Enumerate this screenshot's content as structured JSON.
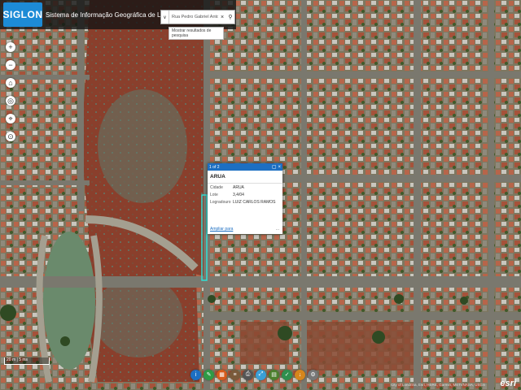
{
  "header": {
    "logo": "SIGLON",
    "title": "Sistema de Informação Geográfica de Londrina"
  },
  "search": {
    "value": "Rua Pedro Gabriel Antonio",
    "suggestion": "Mostrar resultados de pesquisa"
  },
  "nav_buttons": [
    "+",
    "−",
    "⌂",
    "◎",
    "⌖",
    "⊙"
  ],
  "popup": {
    "nav": "1 of 2",
    "title": "ARUA",
    "attributes": [
      {
        "key": "Cidade",
        "value": "ARUA"
      },
      {
        "key": "Lote",
        "value": "3,4/04"
      },
      {
        "key": "Logradouro",
        "value": "LUIZ CARLOS RAMOS"
      }
    ],
    "footer": "Ampliar para",
    "more": "..."
  },
  "toolbar": [
    {
      "icon": "info-icon",
      "color": "#1d6fc2",
      "glyph": "i"
    },
    {
      "icon": "pencil-icon",
      "color": "#2e9b45",
      "glyph": "✎"
    },
    {
      "icon": "grid-icon",
      "color": "#d65a1b",
      "glyph": "▦"
    },
    {
      "icon": "layers-icon",
      "color": "#7a5a3a",
      "glyph": "≡"
    },
    {
      "icon": "print-icon",
      "color": "#555555",
      "glyph": "⎙"
    },
    {
      "icon": "measure-icon",
      "color": "#3a9fd6",
      "glyph": "⤢"
    },
    {
      "icon": "table-icon",
      "color": "#4d7f2e",
      "glyph": "▤"
    },
    {
      "icon": "check-icon",
      "color": "#2f8f4e",
      "glyph": "✓"
    },
    {
      "icon": "download-icon",
      "color": "#d6861b",
      "glyph": "↓"
    },
    {
      "icon": "settings-icon",
      "color": "#777777",
      "glyph": "⚙"
    }
  ],
  "scale_label": "20 m | 5 ms",
  "attribution": "City of Londrina, Esri, HERE, Garmin, METI/NASA, USGS",
  "esri_logo": "esri",
  "colors": {
    "accent": "#1d6fc2",
    "logo_bg": "#1d8bd6"
  }
}
